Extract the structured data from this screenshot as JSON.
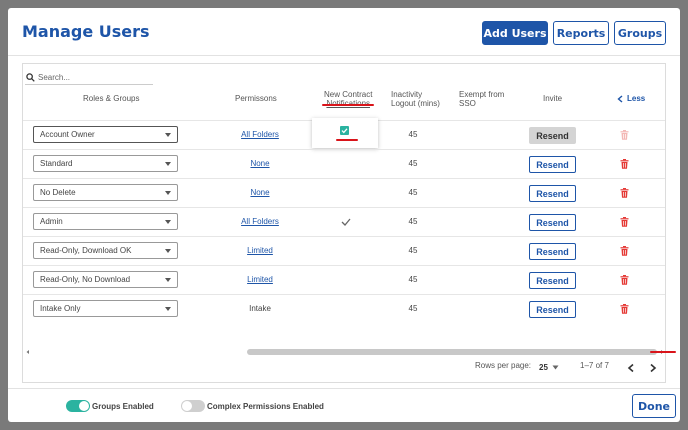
{
  "header": {
    "title": "Manage Users",
    "buttons": [
      "Add Users",
      "Reports",
      "Groups"
    ]
  },
  "search": {
    "placeholder": "Search..."
  },
  "columns": {
    "roles": "Roles & Groups",
    "permissions": "Permissons",
    "notif_line1": "New Contract",
    "notif_line2": "Notifications",
    "inact_line1": "Inactivity",
    "inact_line2": "Logout (mins)",
    "exempt_line1": "Exempt from",
    "exempt_line2": "SSO",
    "invite": "Invite",
    "less": "Less"
  },
  "rows": [
    {
      "role": "Account Owner",
      "permission": "All Folders",
      "perm_link": true,
      "notification": "checked-box",
      "inactivity": "45",
      "resend": "Resend",
      "resend_enabled": false
    },
    {
      "role": "Standard",
      "permission": "None",
      "perm_link": true,
      "notification": "",
      "inactivity": "45",
      "resend": "Resend",
      "resend_enabled": true
    },
    {
      "role": "No Delete",
      "permission": "None",
      "perm_link": true,
      "notification": "",
      "inactivity": "45",
      "resend": "Resend",
      "resend_enabled": true
    },
    {
      "role": "Admin",
      "permission": "All Folders",
      "perm_link": true,
      "notification": "check",
      "inactivity": "45",
      "resend": "Resend",
      "resend_enabled": true
    },
    {
      "role": "Read-Only, Download OK",
      "permission": "Limited",
      "perm_link": true,
      "notification": "",
      "inactivity": "45",
      "resend": "Resend",
      "resend_enabled": true
    },
    {
      "role": "Read-Only, No Download",
      "permission": "Limited",
      "perm_link": true,
      "notification": "",
      "inactivity": "45",
      "resend": "Resend",
      "resend_enabled": true
    },
    {
      "role": "Intake Only",
      "permission": "Intake",
      "perm_link": false,
      "notification": "",
      "inactivity": "45",
      "resend": "Resend",
      "resend_enabled": true
    }
  ],
  "pagination": {
    "rows_per_page_label": "Rows per page:",
    "rows_per_page_value": "25",
    "range": "1–7 of 7"
  },
  "toggles": [
    {
      "label": "Groups Enabled",
      "on": true
    },
    {
      "label": "Complex Permissions Enabled",
      "on": false
    }
  ],
  "done_label": "Done",
  "colors": {
    "primary": "#1e55a8",
    "toggle_on": "#2bb3a0",
    "delete_red": "#e53935",
    "annotation_red": "#d9141a"
  }
}
